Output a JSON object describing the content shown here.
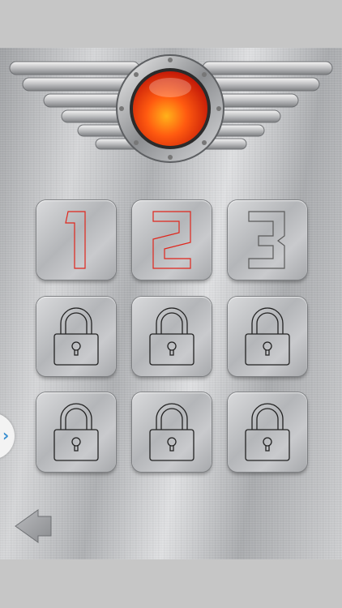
{
  "levels": [
    {
      "label": "1",
      "state": "unlocked",
      "outline_color": "#e0261c"
    },
    {
      "label": "2",
      "state": "unlocked",
      "outline_color": "#e0261c"
    },
    {
      "label": "3",
      "state": "unlocked",
      "outline_color": "#5a5a5a"
    },
    {
      "label": "",
      "state": "locked",
      "icon": "padlock-icon"
    },
    {
      "label": "",
      "state": "locked",
      "icon": "padlock-icon"
    },
    {
      "label": "",
      "state": "locked",
      "icon": "padlock-icon"
    },
    {
      "label": "",
      "state": "locked",
      "icon": "padlock-icon"
    },
    {
      "label": "",
      "state": "locked",
      "icon": "padlock-icon"
    },
    {
      "label": "",
      "state": "locked",
      "icon": "padlock-icon"
    }
  ],
  "emblem": {
    "icon": "winged-red-button-icon",
    "button_color": "#e8380f"
  },
  "navigation": {
    "back_icon": "back-arrow-icon",
    "side_handle_icon": "chevron-right-icon",
    "side_handle_glyph": "›"
  },
  "colors": {
    "accent_red": "#e0261c",
    "panel": "#c3c4c6"
  }
}
